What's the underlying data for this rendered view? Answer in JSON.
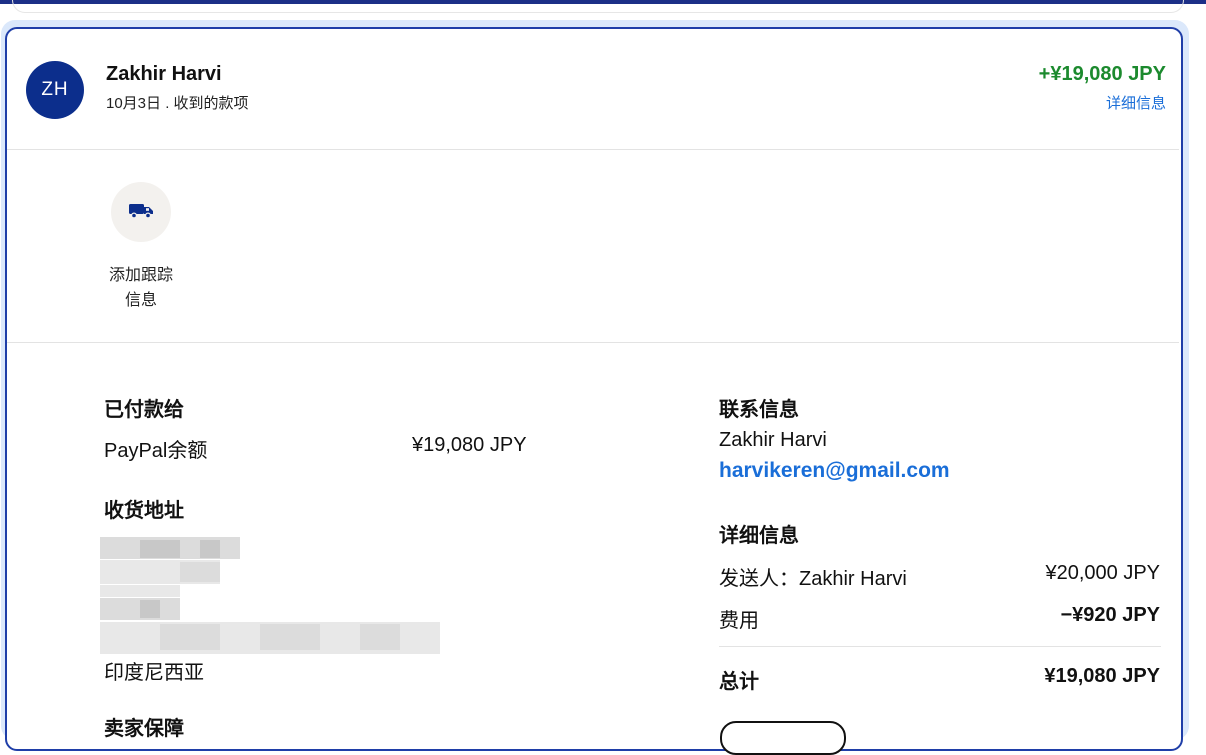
{
  "header": {
    "avatar_initials": "ZH",
    "name": "Zakhir Harvi",
    "subtitle": "10月3日 . 收到的款项",
    "amount": "+¥19,080 JPY",
    "details_link": "详细信息"
  },
  "tracking": {
    "icon": "truck-icon",
    "label_line1": "添加跟踪",
    "label_line2": "信息"
  },
  "paid_to": {
    "title": "已付款给",
    "method": "PayPal余额",
    "amount": "¥19,080 JPY"
  },
  "shipping": {
    "title": "收货地址",
    "country": "印度尼西亚"
  },
  "seller_protection": {
    "title": "卖家保障"
  },
  "contact": {
    "title": "联系信息",
    "name": "Zakhir Harvi",
    "email": "harvikeren@gmail.com"
  },
  "details": {
    "title": "详细信息",
    "sender_label": "发送人：Zakhir Harvi",
    "sender_amount": "¥20,000 JPY",
    "fee_label": "费用",
    "fee_amount": "−¥920 JPY",
    "total_label": "总计",
    "total_amount": "¥19,080 JPY"
  },
  "colors": {
    "accent": "#1f3ea8",
    "positive": "#1c8a2e",
    "link": "#1a6ed8",
    "avatar": "#0c2e8c"
  }
}
